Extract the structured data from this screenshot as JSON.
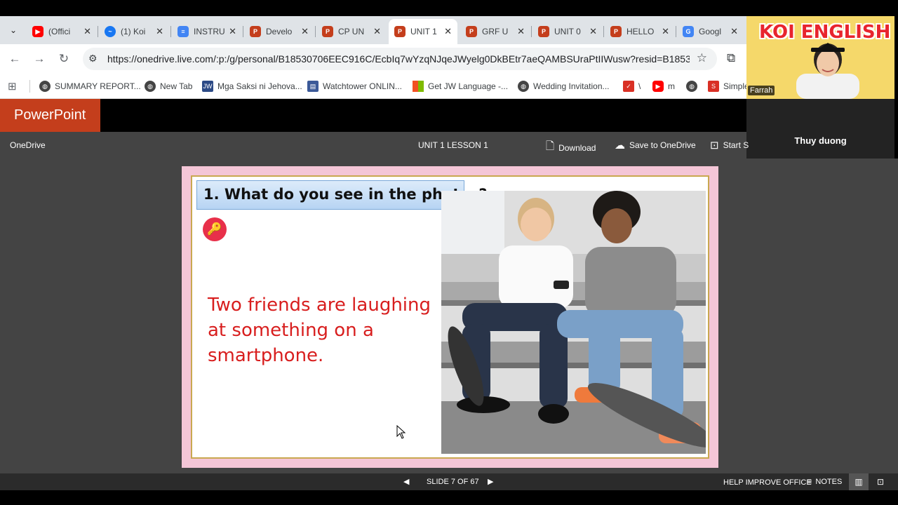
{
  "browser": {
    "tabs": [
      {
        "title": "(Offici",
        "favicon_color": "#ff0000",
        "icon": "youtube-icon"
      },
      {
        "title": "(1) Koi",
        "favicon_color": "#1877f2",
        "icon": "messenger-icon"
      },
      {
        "title": "INSTRU",
        "favicon_color": "#4285f4",
        "icon": "docs-icon"
      },
      {
        "title": "Develo",
        "favicon_color": "#c43e1c",
        "icon": "powerpoint-icon"
      },
      {
        "title": "CP UN",
        "favicon_color": "#c43e1c",
        "icon": "powerpoint-icon"
      },
      {
        "title": "UNIT 1",
        "favicon_color": "#c43e1c",
        "icon": "powerpoint-icon",
        "active": true
      },
      {
        "title": "GRF U",
        "favicon_color": "#c43e1c",
        "icon": "powerpoint-icon"
      },
      {
        "title": "UNIT 0",
        "favicon_color": "#c43e1c",
        "icon": "powerpoint-icon"
      },
      {
        "title": "HELLO",
        "favicon_color": "#c43e1c",
        "icon": "powerpoint-icon"
      },
      {
        "title": "Googl",
        "favicon_color": "#4285f4",
        "icon": "google-translate-icon"
      }
    ],
    "url": "https://onedrive.live.com/:p:/g/personal/B18530706EEC916C/EcbIq7wYzqNJqeJWyelg0DkBEtr7aeQAMBSUraPtIIWusw?resid=B1853070...",
    "bookmarks": [
      {
        "label": "SUMMARY REPORT...",
        "icon": "globe-icon"
      },
      {
        "label": "New Tab",
        "icon": "globe-icon"
      },
      {
        "label": "Mga Saksi ni Jehova...",
        "icon": "jw-icon"
      },
      {
        "label": "Watchtower ONLIN...",
        "icon": "library-icon"
      },
      {
        "label": "Get JW Language -...",
        "icon": "microsoft-icon"
      },
      {
        "label": "Wedding Invitation...",
        "icon": "globe-icon"
      },
      {
        "label": "\\",
        "icon": "app-icon"
      },
      {
        "label": "m",
        "icon": "youtube-icon"
      },
      {
        "label": "",
        "icon": "globe-icon"
      },
      {
        "label": "Simple",
        "icon": "s-icon"
      }
    ]
  },
  "video": {
    "brand": "KOI ENGLISH",
    "host_name": "Farrah",
    "participant_name": "Thuy duong"
  },
  "powerpoint": {
    "app_name": "PowerPoint",
    "onedrive_label": "OneDrive",
    "doc_title": "UNIT 1 LESSON 1",
    "download_label": "Download",
    "save_label": "Save to OneDrive",
    "start_label": "Start S"
  },
  "slide": {
    "title": "1. What do you see in the photos?",
    "answer": "Two friends are laughing at something on a smartphone."
  },
  "footer": {
    "slide_counter": "SLIDE 7 OF 67",
    "help": "HELP IMPROVE OFFICE",
    "notes": "NOTES"
  }
}
